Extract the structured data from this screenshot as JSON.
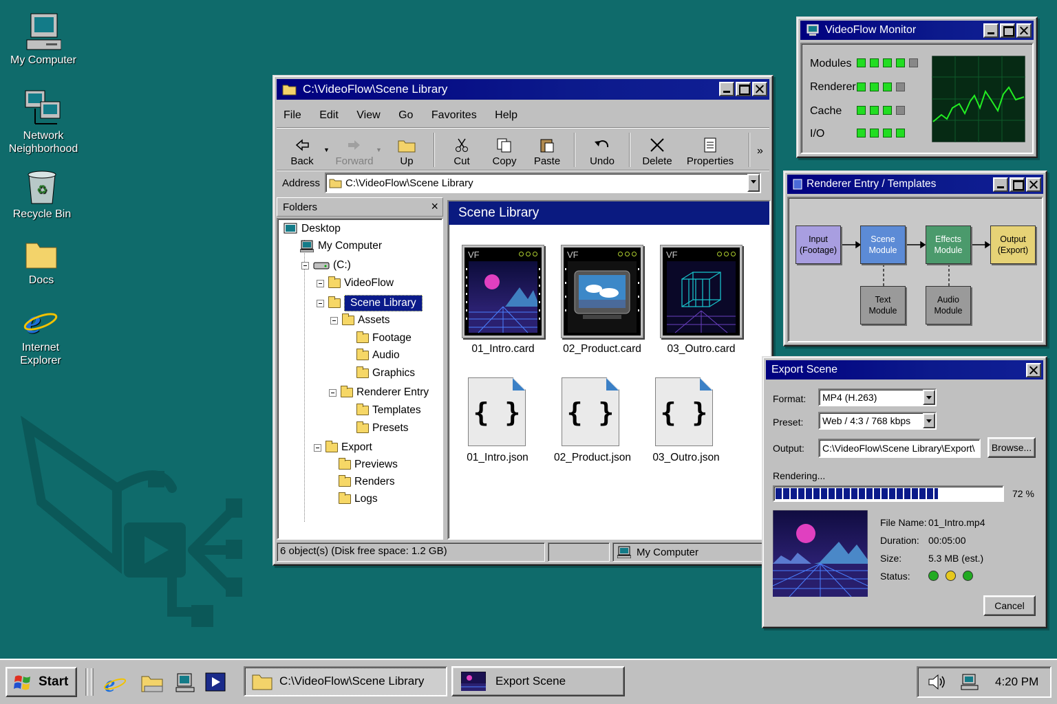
{
  "desktop": {
    "icons": [
      {
        "label": "My Computer"
      },
      {
        "label": "Network Neighborhood"
      },
      {
        "label": "Recycle Bin"
      },
      {
        "label": "Docs"
      },
      {
        "label": "Internet Explorer"
      }
    ]
  },
  "explorer": {
    "title": "C:\\VideoFlow\\Scene Library",
    "menu": [
      "File",
      "Edit",
      "View",
      "Go",
      "Favorites",
      "Help"
    ],
    "toolbar": {
      "back": "Back",
      "forward": "Forward",
      "up": "Up",
      "cut": "Cut",
      "copy": "Copy",
      "paste": "Paste",
      "undo": "Undo",
      "delete": "Delete",
      "properties": "Properties"
    },
    "address_label": "Address",
    "address_value": "C:\\VideoFlow\\Scene Library",
    "folders_label": "Folders",
    "tree": {
      "desktop": "Desktop",
      "my_computer": "My Computer",
      "drive": "(C:)",
      "videoflow": "VideoFlow",
      "scene_library": "Scene Library",
      "assets": "Assets",
      "footage": "Footage",
      "audio": "Audio",
      "graphics": "Graphics",
      "renderer_entry": "Renderer Entry",
      "templates": "Templates",
      "presets": "Presets",
      "export": "Export",
      "previews": "Previews",
      "renders": "Renders",
      "logs": "Logs"
    },
    "content_title": "Scene Library",
    "card_badge": "VF",
    "files": [
      {
        "name": "01_Intro.card"
      },
      {
        "name": "02_Product.card"
      },
      {
        "name": "03_Outro.card"
      },
      {
        "name": "01_Intro.json"
      },
      {
        "name": "02_Product.json"
      },
      {
        "name": "03_Outro.json"
      }
    ],
    "json_glyph": "{ }",
    "status": {
      "objects": "6 object(s) (Disk free space: 1.2 GB)",
      "location": "My Computer"
    }
  },
  "monitor": {
    "title": "VideoFlow Monitor",
    "rows": [
      {
        "label": "Modules",
        "on": 4,
        "total": 5
      },
      {
        "label": "Renderer",
        "on": 3,
        "total": 4
      },
      {
        "label": "Cache",
        "on": 3,
        "total": 4
      },
      {
        "label": "I/O",
        "on": 4,
        "total": 4
      }
    ]
  },
  "renderer": {
    "title": "Renderer Entry / Templates",
    "nodes": {
      "input": "Input\n(Footage)",
      "scene": "Scene\nModule",
      "effects": "Effects\nModule",
      "output": "Output\n(Export)",
      "text": "Text\nModule",
      "audio": "Audio\nModule"
    },
    "colors": {
      "input": "#a89ee0",
      "scene": "#5c8bd6",
      "effects": "#4b9a6c",
      "output": "#e6d276",
      "module": "#9a9a9a"
    }
  },
  "export": {
    "title": "Export Scene",
    "format_label": "Format:",
    "format_value": "MP4 (H.263)",
    "preset_label": "Preset:",
    "preset_value": "Web / 4:3 / 768 kbps",
    "output_label": "Output:",
    "output_value": "C:\\VideoFlow\\Scene Library\\Export\\",
    "browse": "Browse...",
    "rendering_label": "Rendering...",
    "progress": 0.72,
    "progress_text": "72 %",
    "file_name_label": "File Name:",
    "file_name": "01_Intro.mp4",
    "duration_label": "Duration:",
    "duration": "00:05:00",
    "size_label": "Size:",
    "size": "5.3 MB (est.)",
    "status_label": "Status:",
    "status_lights": [
      "#22aa22",
      "#e6c81e",
      "#22aa22"
    ],
    "cancel": "Cancel"
  },
  "taskbar": {
    "start": "Start",
    "tasks": [
      "C:\\VideoFlow\\Scene Library",
      "Export Scene"
    ],
    "time": "4:20 PM"
  }
}
